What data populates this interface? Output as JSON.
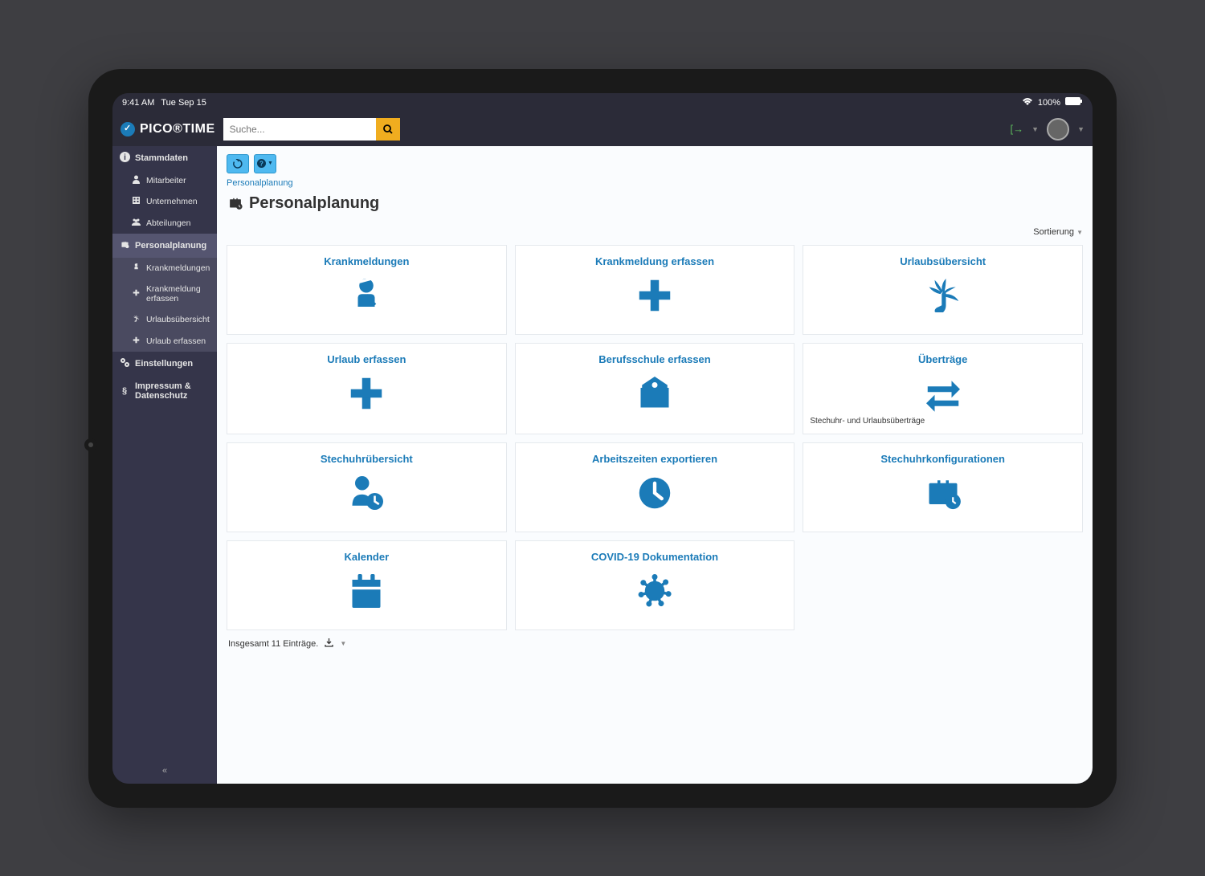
{
  "status": {
    "time": "9:41 AM",
    "date": "Tue Sep 15",
    "battery": "100%"
  },
  "brand": "PICO®TIME",
  "search": {
    "placeholder": "Suche..."
  },
  "sidebar": {
    "groups": [
      {
        "label": "Stammdaten",
        "items": [
          {
            "label": "Mitarbeiter"
          },
          {
            "label": "Unternehmen"
          },
          {
            "label": "Abteilungen"
          }
        ]
      },
      {
        "label": "Personalplanung",
        "active": true,
        "items": [
          {
            "label": "Krankmeldungen"
          },
          {
            "label": "Krankmeldung erfassen"
          },
          {
            "label": "Urlaubsübersicht"
          },
          {
            "label": "Urlaub erfassen"
          }
        ]
      },
      {
        "label": "Einstellungen",
        "items": []
      },
      {
        "label": "Impressum & Datenschutz",
        "items": []
      }
    ]
  },
  "breadcrumb": "Personalplanung",
  "page_title": "Personalplanung",
  "sort_label": "Sortierung",
  "cards": [
    {
      "title": "Krankmeldungen",
      "icon": "injured-person"
    },
    {
      "title": "Krankmeldung erfassen",
      "icon": "plus"
    },
    {
      "title": "Urlaubsübersicht",
      "icon": "palm-tree"
    },
    {
      "title": "Urlaub erfassen",
      "icon": "plus"
    },
    {
      "title": "Berufsschule erfassen",
      "icon": "school"
    },
    {
      "title": "Überträge",
      "icon": "transfer",
      "subtitle": "Stechuhr- und Urlaubsüberträge"
    },
    {
      "title": "Stechuhrübersicht",
      "icon": "user-clock"
    },
    {
      "title": "Arbeitszeiten exportieren",
      "icon": "clock"
    },
    {
      "title": "Stechuhrkonfigurationen",
      "icon": "briefcase-clock"
    },
    {
      "title": "Kalender",
      "icon": "calendar"
    },
    {
      "title": "COVID-19 Dokumentation",
      "icon": "virus"
    }
  ],
  "footer": "Insgesamt 11 Einträge."
}
